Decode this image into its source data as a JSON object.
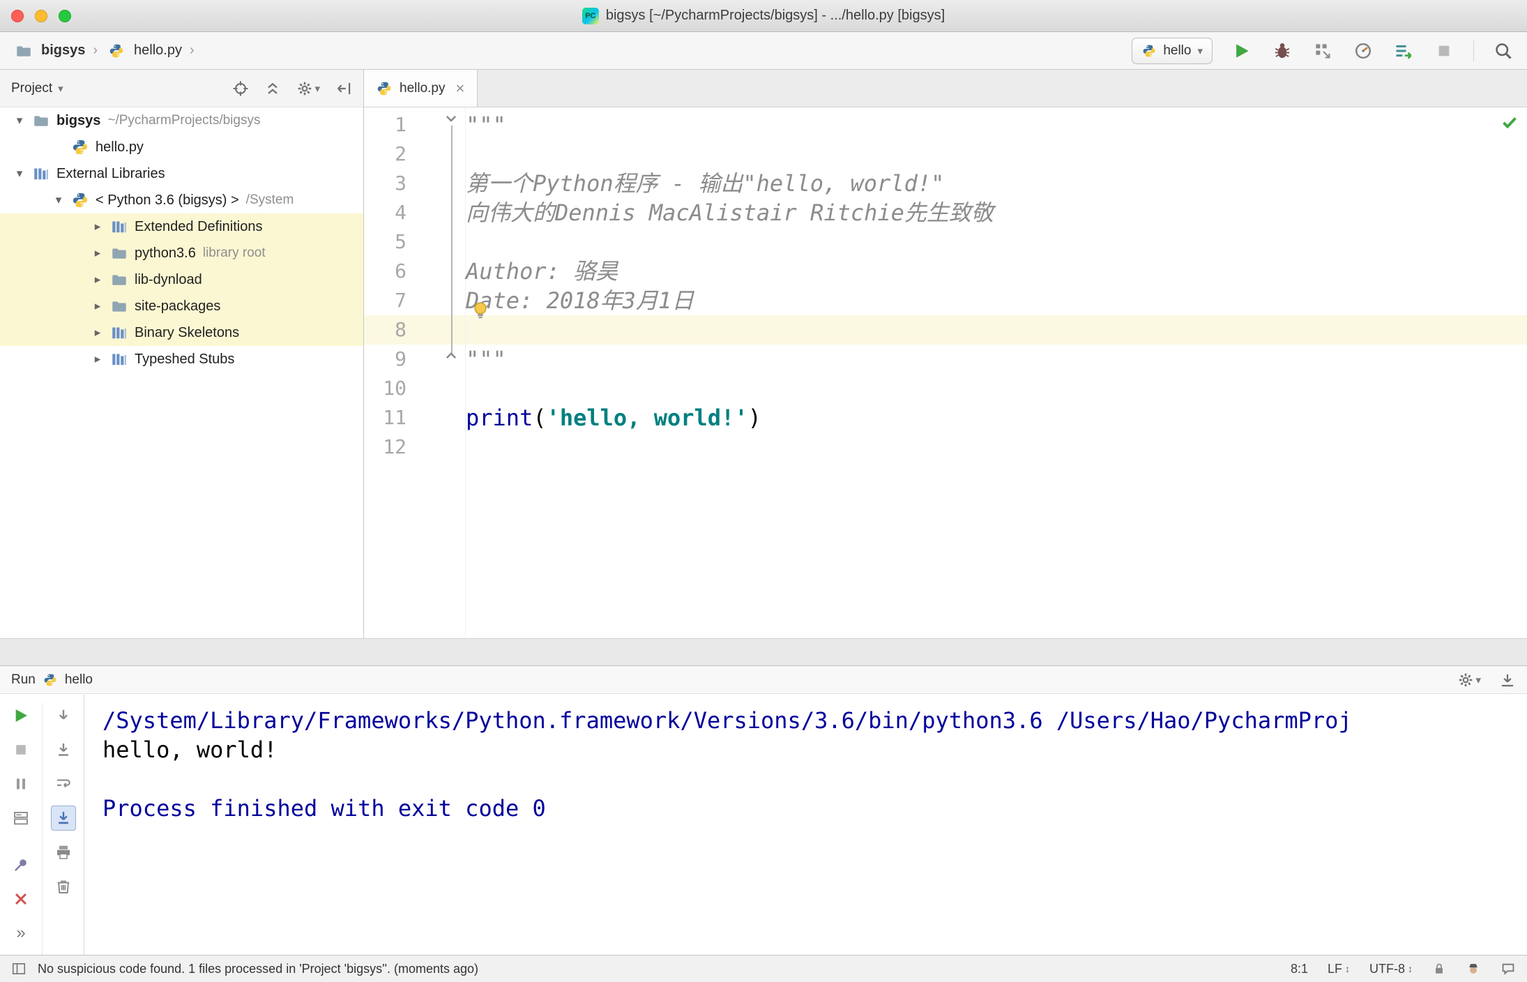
{
  "colors": {
    "accent_green": "#3fa83f",
    "selection_yellow": "#fbf7d2",
    "current_line": "#fcf9e2",
    "keyword_color": "#00009c",
    "string_color": "#008080",
    "console_info": "#00009c",
    "error_red": "#d25252"
  },
  "icons": {
    "caret_down": "▾",
    "chevron_sep": "›",
    "expand_down": "▾",
    "expand_right": "▸",
    "updown": "↕",
    "more_chevrons": "»",
    "close_tab": "×"
  },
  "window": {
    "title": "bigsys [~/PycharmProjects/bigsys] - .../hello.py [bigsys]"
  },
  "breadcrumbs": {
    "project": "bigsys",
    "file": "hello.py"
  },
  "toolbar": {
    "run_config": "hello"
  },
  "project_panel": {
    "title": "Project",
    "tree": [
      {
        "arrow": "down",
        "icon": "folder",
        "label": "bigsys",
        "bold": true,
        "suffix": "~/PycharmProjects/bigsys",
        "indent": 0,
        "highlight": false
      },
      {
        "arrow": null,
        "icon": "pyfile",
        "label": "hello.py",
        "indent": 1,
        "highlight": false
      },
      {
        "arrow": "down",
        "icon": "library",
        "label": "External Libraries",
        "indent": 0,
        "highlight": false
      },
      {
        "arrow": "down",
        "icon": "python",
        "label": "< Python 3.6 (bigsys) >",
        "suffix": "/System",
        "indent": 1,
        "highlight": false
      },
      {
        "arrow": "right",
        "icon": "library",
        "label": "Extended Definitions",
        "indent": 2,
        "highlight": true
      },
      {
        "arrow": "right",
        "icon": "folder",
        "label": "python3.6",
        "suffix": "library root",
        "indent": 2,
        "highlight": true
      },
      {
        "arrow": "right",
        "icon": "folder",
        "label": "lib-dynload",
        "indent": 2,
        "highlight": true
      },
      {
        "arrow": "right",
        "icon": "folder",
        "label": "site-packages",
        "indent": 2,
        "highlight": true
      },
      {
        "arrow": "right",
        "icon": "library",
        "label": "Binary Skeletons",
        "indent": 2,
        "highlight": true
      },
      {
        "arrow": "right",
        "icon": "library",
        "label": "Typeshed Stubs",
        "indent": 2,
        "highlight": false
      }
    ]
  },
  "editor": {
    "tab": "hello.py",
    "lines": [
      {
        "n": 1,
        "seg": [
          {
            "t": "\"\"\"",
            "c": "doc"
          }
        ]
      },
      {
        "n": 2,
        "seg": []
      },
      {
        "n": 3,
        "seg": [
          {
            "t": "第一个Python程序 - 输出\"hello, world!\"",
            "c": "doc"
          }
        ]
      },
      {
        "n": 4,
        "seg": [
          {
            "t": "向伟大的Dennis MacAlistair Ritchie先生致敬",
            "c": "doc"
          }
        ]
      },
      {
        "n": 5,
        "seg": []
      },
      {
        "n": 6,
        "seg": [
          {
            "t": "Author: 骆昊",
            "c": "doc"
          }
        ]
      },
      {
        "n": 7,
        "seg": [
          {
            "t": "Date: 2018年3月1日",
            "c": "doc"
          }
        ]
      },
      {
        "n": 8,
        "seg": [],
        "highlight": true
      },
      {
        "n": 9,
        "seg": [
          {
            "t": "\"\"\"",
            "c": "doc"
          }
        ]
      },
      {
        "n": 10,
        "seg": []
      },
      {
        "n": 11,
        "seg": [
          {
            "t": "print",
            "c": "builtin"
          },
          {
            "t": "(",
            "c": "plain"
          },
          {
            "t": "'hello, world!'",
            "c": "string"
          },
          {
            "t": ")",
            "c": "plain"
          }
        ]
      },
      {
        "n": 12,
        "seg": []
      }
    ]
  },
  "run_panel": {
    "title": "Run",
    "config": "hello"
  },
  "console": {
    "lines": [
      {
        "t": "/System/Library/Frameworks/Python.framework/Versions/3.6/bin/python3.6 /Users/Hao/PycharmProj",
        "c": "sys"
      },
      {
        "t": "hello, world!",
        "c": "out"
      },
      {
        "t": "",
        "c": "out"
      },
      {
        "t": "Process finished with exit code 0",
        "c": "sys"
      }
    ]
  },
  "status_bar": {
    "message": "No suspicious code found. 1 files processed in 'Project 'bigsys''. (moments ago)",
    "caret_position": "8:1",
    "line_separator": "LF",
    "encoding": "UTF-8"
  }
}
